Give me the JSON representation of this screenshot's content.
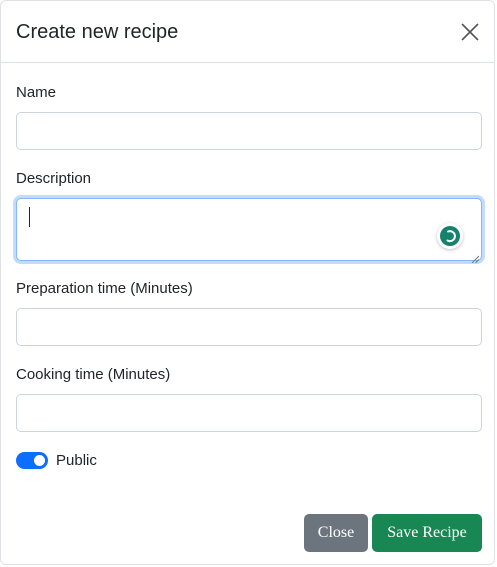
{
  "modal": {
    "title": "Create new recipe"
  },
  "fields": {
    "name": {
      "label": "Name",
      "value": "",
      "placeholder": ""
    },
    "description": {
      "label": "Description",
      "value": ""
    },
    "preparation_time": {
      "label": "Preparation time (Minutes)",
      "value": "",
      "placeholder": ""
    },
    "cooking_time": {
      "label": "Cooking time (Minutes)",
      "value": "",
      "placeholder": ""
    }
  },
  "public_toggle": {
    "label": "Public",
    "checked": true
  },
  "footer": {
    "close_label": "Close",
    "save_label": "Save Recipe"
  },
  "colors": {
    "primary": "#0d6efd",
    "secondary": "#6c757d",
    "success": "#198754",
    "grammar_badge": "#15826b"
  },
  "icons": {
    "close": "close-icon",
    "grammar_assistant": "grammar-assistant-icon",
    "resize": "resize-grip-icon"
  }
}
